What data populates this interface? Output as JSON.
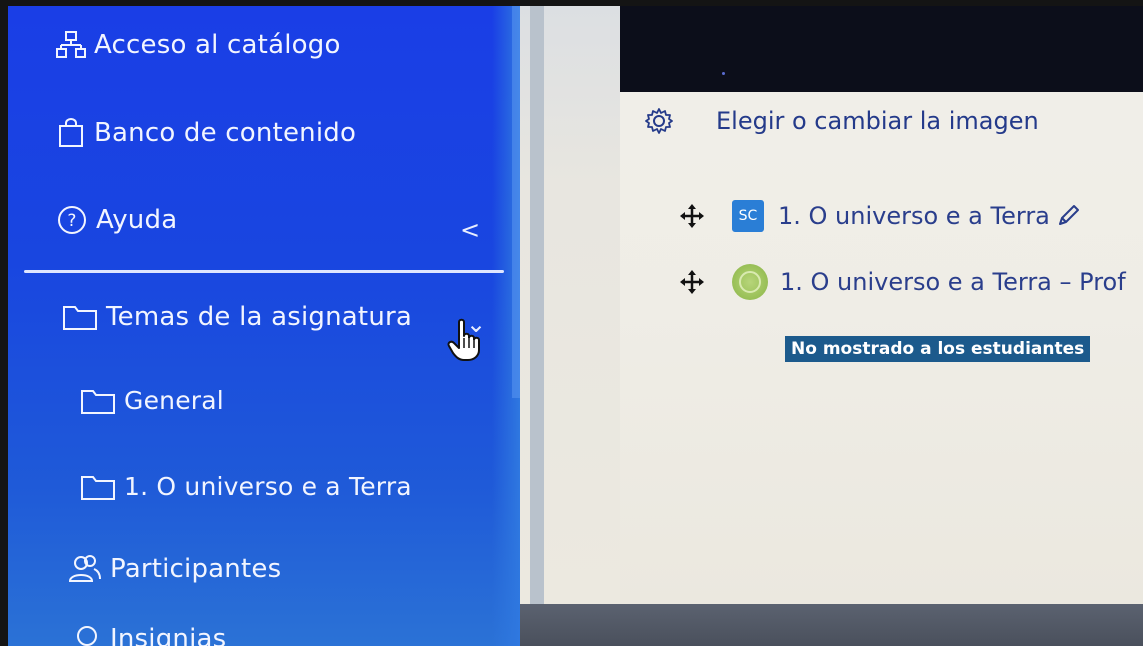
{
  "sidebar": {
    "items": [
      {
        "label": "Acceso al catálogo",
        "icon": "sitemap-icon"
      },
      {
        "label": "Banco de contenido",
        "icon": "bag-icon"
      },
      {
        "label": "Ayuda",
        "icon": "help-icon"
      },
      {
        "label": "Temas de la asignatura",
        "icon": "folder-icon"
      },
      {
        "label": "General",
        "icon": "folder-icon"
      },
      {
        "label": "1. O universo e a Terra",
        "icon": "folder-icon"
      },
      {
        "label": "Participantes",
        "icon": "users-icon"
      },
      {
        "label": "Insignias",
        "icon": "badge-icon"
      }
    ],
    "collapse_chevron": "<",
    "expand_chevron": "⌄"
  },
  "content": {
    "change_image_label": "Elegir o cambiar la imagen",
    "activities": [
      {
        "title": "1. O universo e a Terra",
        "icon_text": "SC"
      },
      {
        "title": "1. O universo e a Terra – Prof"
      }
    ],
    "visibility_badge": "No mostrado a los estudiantes"
  },
  "colors": {
    "sidebar_bg": "#1a3ee6",
    "content_bg": "#f1efe9",
    "link_text": "#2a3e8c",
    "badge_bg": "#1c5a8c"
  }
}
